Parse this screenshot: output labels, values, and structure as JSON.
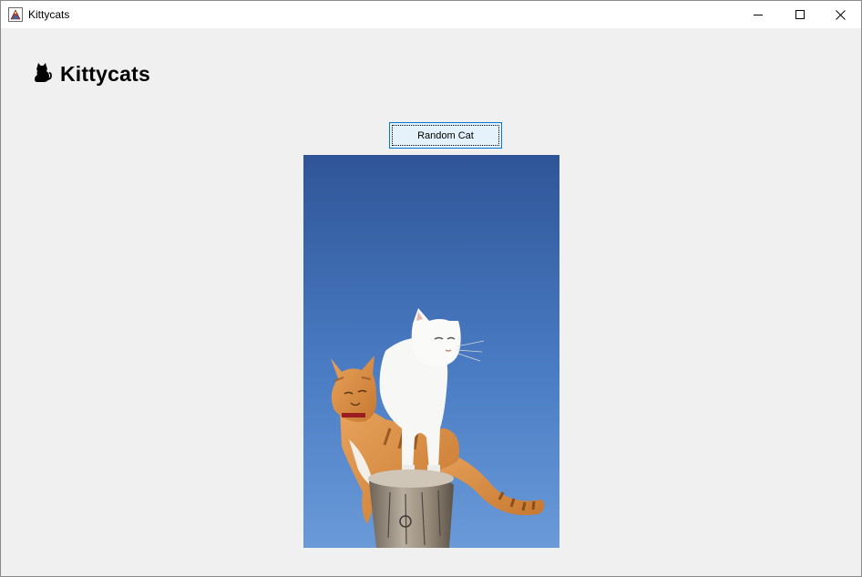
{
  "window": {
    "title": "Kittycats",
    "controls": {
      "minimize": "minimize-icon",
      "maximize": "maximize-icon",
      "close": "close-icon"
    }
  },
  "header": {
    "icon": "cat-icon",
    "title": "Kittycats"
  },
  "actions": {
    "random_label": "Random Cat"
  },
  "image": {
    "subject": "cat-photo"
  },
  "colors": {
    "background": "#f0f0f0",
    "titlebar": "#ffffff",
    "button_fill": "#e5f1fb",
    "button_border": "#0078d7",
    "sky_top": "#2f5597",
    "sky_bottom": "#6a9ad8"
  }
}
